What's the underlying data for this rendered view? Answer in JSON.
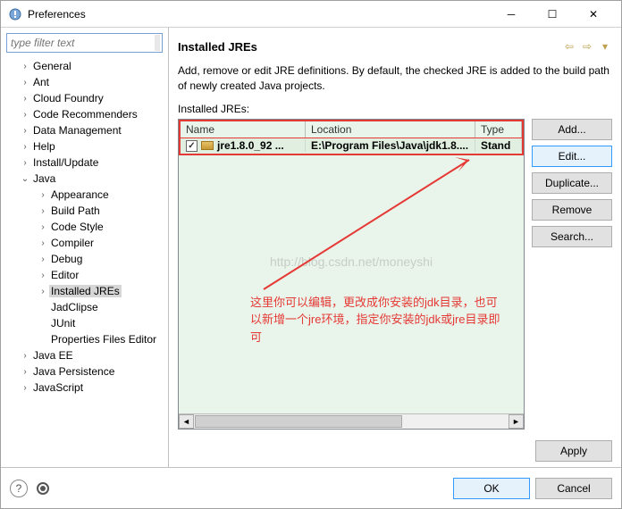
{
  "window": {
    "title": "Preferences"
  },
  "filter": {
    "placeholder": "type filter text"
  },
  "tree": [
    {
      "label": "General",
      "twisty": ">",
      "indent": 1
    },
    {
      "label": "Ant",
      "twisty": ">",
      "indent": 1
    },
    {
      "label": "Cloud Foundry",
      "twisty": ">",
      "indent": 1
    },
    {
      "label": "Code Recommenders",
      "twisty": ">",
      "indent": 1
    },
    {
      "label": "Data Management",
      "twisty": ">",
      "indent": 1
    },
    {
      "label": "Help",
      "twisty": ">",
      "indent": 1
    },
    {
      "label": "Install/Update",
      "twisty": ">",
      "indent": 1
    },
    {
      "label": "Java",
      "twisty": "v",
      "indent": 1
    },
    {
      "label": "Appearance",
      "twisty": ">",
      "indent": 2
    },
    {
      "label": "Build Path",
      "twisty": ">",
      "indent": 2
    },
    {
      "label": "Code Style",
      "twisty": ">",
      "indent": 2
    },
    {
      "label": "Compiler",
      "twisty": ">",
      "indent": 2
    },
    {
      "label": "Debug",
      "twisty": ">",
      "indent": 2
    },
    {
      "label": "Editor",
      "twisty": ">",
      "indent": 2
    },
    {
      "label": "Installed JREs",
      "twisty": ">",
      "indent": 2,
      "selected": true
    },
    {
      "label": "JadClipse",
      "twisty": "",
      "indent": 2
    },
    {
      "label": "JUnit",
      "twisty": "",
      "indent": 2
    },
    {
      "label": "Properties Files Editor",
      "twisty": "",
      "indent": 2
    },
    {
      "label": "Java EE",
      "twisty": ">",
      "indent": 1
    },
    {
      "label": "Java Persistence",
      "twisty": ">",
      "indent": 1
    },
    {
      "label": "JavaScript",
      "twisty": ">",
      "indent": 1
    }
  ],
  "page": {
    "title": "Installed JREs",
    "description": "Add, remove or edit JRE definitions. By default, the checked JRE is added to the build path of newly created Java projects.",
    "table_label": "Installed JREs:",
    "columns": {
      "name": "Name",
      "location": "Location",
      "type": "Type"
    },
    "rows": [
      {
        "name": "jre1.8.0_92 ...",
        "location": "E:\\Program Files\\Java\\jdk1.8....",
        "type": "Stand",
        "checked": true
      }
    ],
    "watermark": "http://blog.csdn.net/moneyshi",
    "annotation": "这里你可以编辑，更改成你安装的jdk目录，也可以新增一个jre环境，指定你安装的jdk或jre目录即可",
    "buttons": {
      "add": "Add...",
      "edit": "Edit...",
      "duplicate": "Duplicate...",
      "remove": "Remove",
      "search": "Search...",
      "apply": "Apply"
    }
  },
  "footer": {
    "ok": "OK",
    "cancel": "Cancel"
  }
}
